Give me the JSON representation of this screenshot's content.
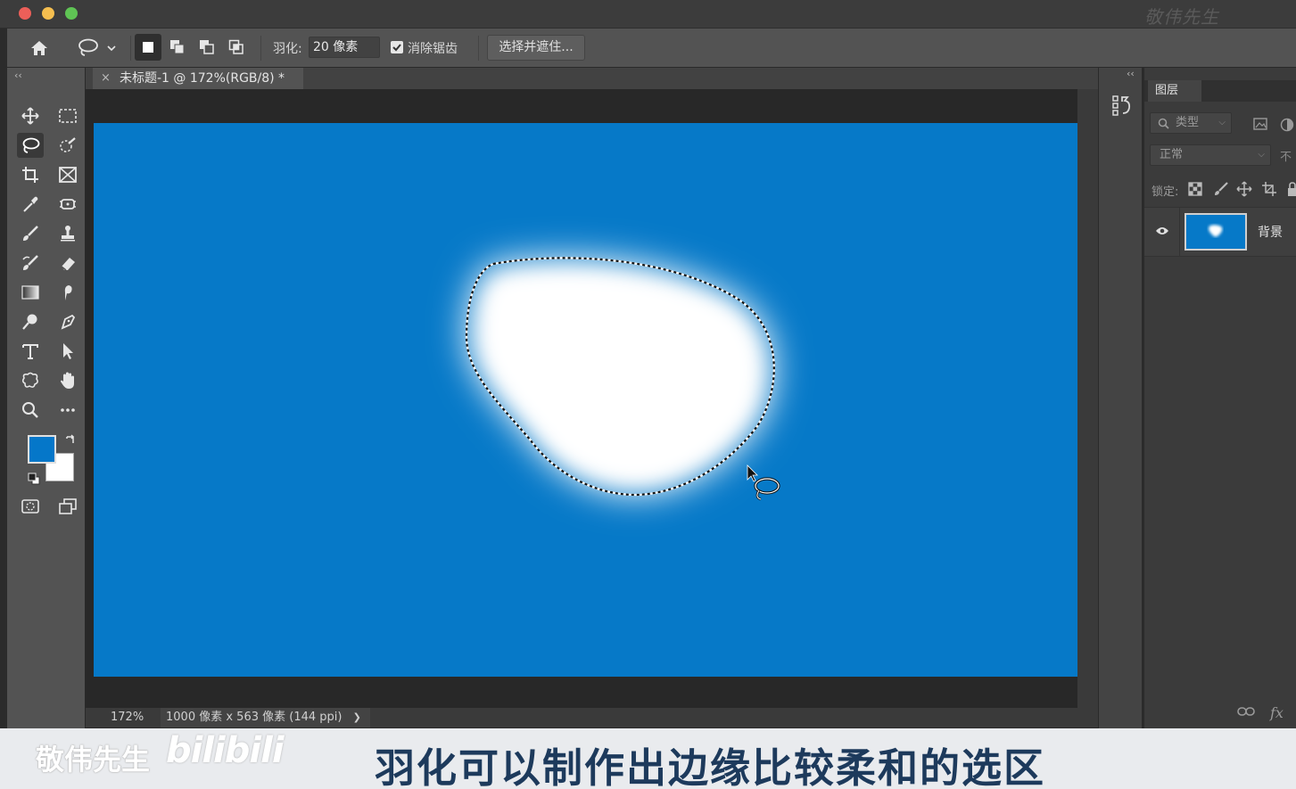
{
  "app": {
    "watermark": "敬伟先生"
  },
  "options_bar": {
    "feather_label": "羽化:",
    "feather_value": "20 像素",
    "antialias_label": "消除锯齿",
    "antialias_checked": true,
    "select_mask_label": "选择并遮住..."
  },
  "document": {
    "tab_close": "×",
    "tab_title": "未标题-1 @ 172%(RGB/8) *",
    "zoom": "172%",
    "size_info": "1000 像素 x 563 像素 (144 ppi)",
    "size_arrow": "❯",
    "canvas_color": "#0679c8"
  },
  "toolbar": {
    "collapse": "‹‹",
    "foreground_color": "#0577c9",
    "background_color": "#ffffff"
  },
  "layers_panel": {
    "collapse": "‹‹",
    "tab": "图层",
    "filter_placeholder": "类型",
    "blend_mode": "正常",
    "opacity_stub": "不",
    "lock_label": "锁定:",
    "layers": [
      {
        "name": "背景",
        "visible": true
      }
    ],
    "fx_label": "fx"
  },
  "subtitle": {
    "brand": "敬伟先生",
    "logo": "bilibili",
    "text": "羽化可以制作出边缘比较柔和的选区"
  }
}
